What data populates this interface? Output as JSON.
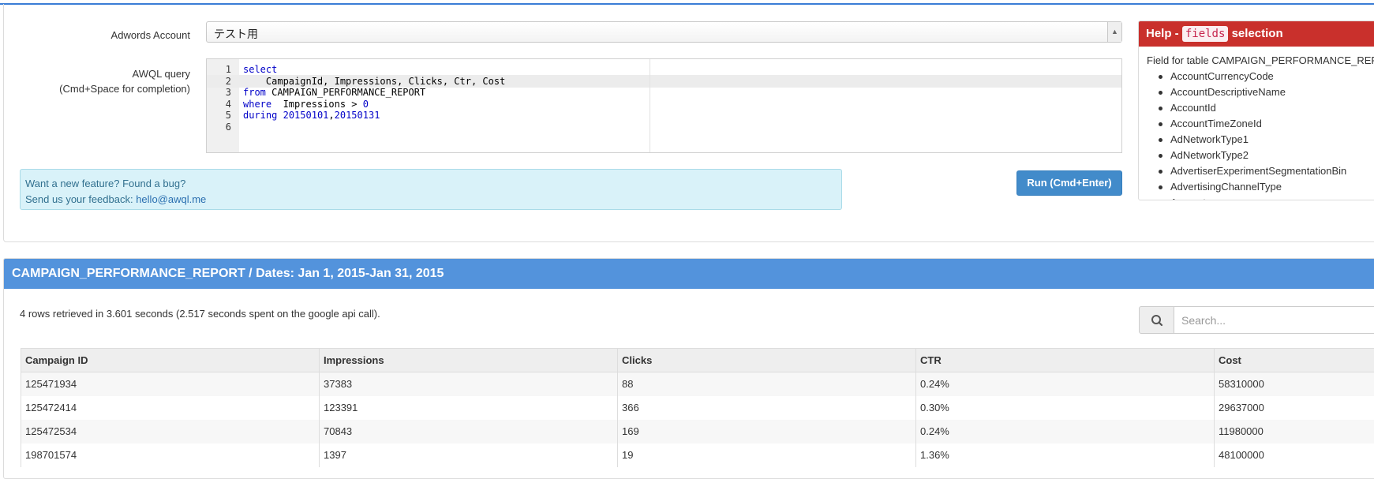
{
  "form": {
    "account_label": "Adwords Account",
    "account_value": "テスト用",
    "query_label": "AWQL query",
    "query_hint": "(Cmd+Space for completion)",
    "run_button": "Run (Cmd+Enter)"
  },
  "editor": {
    "line_numbers": [
      "1",
      "2",
      "3",
      "4",
      "5",
      "6"
    ],
    "active_line": 2,
    "lines": [
      "select",
      "    CampaignId, Impressions, Clicks, Ctr, Cost",
      "from CAMPAIGN_PERFORMANCE_REPORT",
      "where  Impressions > 0",
      "during 20150101,20150131",
      ""
    ]
  },
  "feedback": {
    "line1": "Want a new feature? Found a bug?",
    "line2_prefix": "Send us your feedback: ",
    "email": "hello@awql.me"
  },
  "help": {
    "title_prefix": "Help - ",
    "title_code": "fields",
    "title_suffix": " selection",
    "intro": "Field for table CAMPAIGN_PERFORMANCE_REPORT",
    "fields": [
      "AccountCurrencyCode",
      "AccountDescriptiveName",
      "AccountId",
      "AccountTimeZoneId",
      "AdNetworkType1",
      "AdNetworkType2",
      "AdvertiserExperimentSegmentationBin",
      "AdvertisingChannelType",
      "Amount"
    ]
  },
  "results": {
    "title": "CAMPAIGN_PERFORMANCE_REPORT / Dates: Jan 1, 2015-Jan 31, 2015",
    "info": "4 rows retrieved in 3.601 seconds (2.517 seconds spent on the google api call).",
    "search_placeholder": "Search...",
    "columns": [
      "Campaign ID",
      "Impressions",
      "Clicks",
      "CTR",
      "Cost"
    ],
    "rows": [
      [
        "125471934",
        "37383",
        "88",
        "0.24%",
        "58310000"
      ],
      [
        "125472414",
        "123391",
        "366",
        "0.30%",
        "29637000"
      ],
      [
        "125472534",
        "70843",
        "169",
        "0.24%",
        "11980000"
      ],
      [
        "198701574",
        "1397",
        "19",
        "1.36%",
        "48100000"
      ]
    ]
  },
  "colors": {
    "accent": "#3a7dd6",
    "results_header": "#5393dc",
    "help_header": "#c9302c",
    "run_button": "#428bca",
    "feedback_bg": "#d9f2f9"
  },
  "icons": {
    "search": "search-icon",
    "dropdown": "chevron-down-icon"
  }
}
